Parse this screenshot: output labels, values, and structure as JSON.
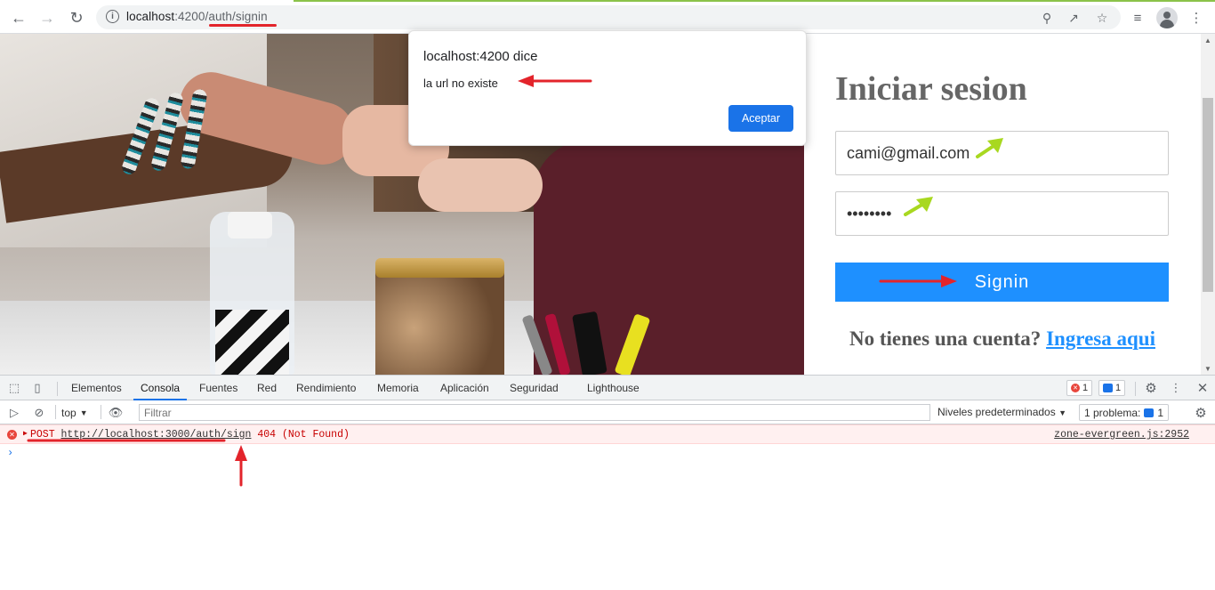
{
  "browser": {
    "url_host": "localhost",
    "url_port": ":4200",
    "url_path": "/auth/signin"
  },
  "alert": {
    "title": "localhost:4200 dice",
    "message": "la url no existe",
    "ok_label": "Aceptar"
  },
  "signin": {
    "heading": "Iniciar sesion",
    "email_value": "cami@gmail.com",
    "password_value": "••••••••",
    "button_label": "Signin",
    "signup_text": "No tienes una cuenta?",
    "signup_link": "Ingresa aqui"
  },
  "devtools": {
    "tabs": [
      "Elementos",
      "Consola",
      "Fuentes",
      "Red",
      "Rendimiento",
      "Memoria",
      "Aplicación",
      "Seguridad",
      "Lighthouse"
    ],
    "error_count": "1",
    "message_count": "1",
    "context": "top",
    "filter_placeholder": "Filtrar",
    "levels": "Niveles predeterminados",
    "problems_label": "1 problema:",
    "problems_count": "1",
    "error_line": {
      "method": "POST",
      "url": "http://localhost:3000/auth/sign",
      "status": "404 (Not Found)",
      "source": "zone-evergreen.js:2952"
    },
    "prompt": "›"
  },
  "colors": {
    "primary_button": "#1e90ff",
    "alert_button": "#1a73e8",
    "annotation_red": "#e3242b",
    "annotation_green": "#a8d820"
  }
}
